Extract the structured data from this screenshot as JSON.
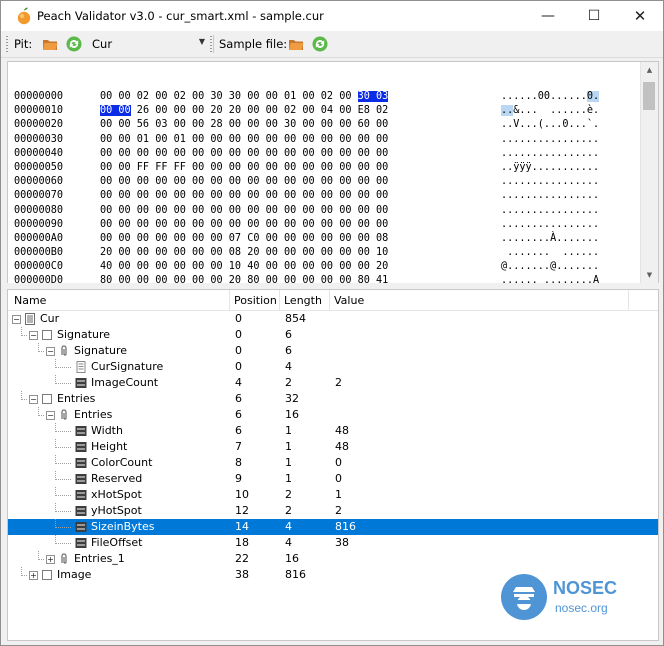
{
  "window": {
    "title": "Peach Validator v3.0 - cur_smart.xml - sample.cur",
    "minimize_glyph": "—",
    "maximize_glyph": "☐",
    "close_glyph": "✕"
  },
  "toolbar": {
    "pit_label": "Pit:",
    "pit_value": "Cur",
    "sample_label": "Sample file:"
  },
  "hex": {
    "rows": [
      {
        "offset": "00000000",
        "bytes_pre": "00 00 02 00 02 00 30 30 00 00 01 00 02 00 ",
        "bytes_sel": "30 03",
        "bytes_post": "",
        "ascii_pre": "......00......",
        "ascii_sel": "0.",
        "ascii_post": ""
      },
      {
        "offset": "00000010",
        "bytes_pre": "",
        "bytes_sel": "00 00",
        "bytes_post": " 26 00 00 00 20 20 00 00 02 00 04 00 E8 02",
        "ascii_pre": "",
        "ascii_sel": "..",
        "ascii_post": "&...  ......è."
      },
      {
        "offset": "00000020",
        "bytes_pre": "00 00 56 03 00 00 28 00 00 00 30 00 00 00 60 00",
        "bytes_sel": "",
        "bytes_post": "",
        "ascii_pre": "..V...(...0...`.",
        "ascii_sel": "",
        "ascii_post": ""
      },
      {
        "offset": "00000030",
        "bytes_pre": "00 00 01 00 01 00 00 00 00 00 00 00 00 00 00 00",
        "bytes_sel": "",
        "bytes_post": "",
        "ascii_pre": "................",
        "ascii_sel": "",
        "ascii_post": ""
      },
      {
        "offset": "00000040",
        "bytes_pre": "00 00 00 00 00 00 00 00 00 00 00 00 00 00 00 00",
        "bytes_sel": "",
        "bytes_post": "",
        "ascii_pre": "................",
        "ascii_sel": "",
        "ascii_post": ""
      },
      {
        "offset": "00000050",
        "bytes_pre": "00 00 FF FF FF 00 00 00 00 00 00 00 00 00 00 00",
        "bytes_sel": "",
        "bytes_post": "",
        "ascii_pre": "..ÿÿÿ...........",
        "ascii_sel": "",
        "ascii_post": ""
      },
      {
        "offset": "00000060",
        "bytes_pre": "00 00 00 00 00 00 00 00 00 00 00 00 00 00 00 00",
        "bytes_sel": "",
        "bytes_post": "",
        "ascii_pre": "................",
        "ascii_sel": "",
        "ascii_post": ""
      },
      {
        "offset": "00000070",
        "bytes_pre": "00 00 00 00 00 00 00 00 00 00 00 00 00 00 00 00",
        "bytes_sel": "",
        "bytes_post": "",
        "ascii_pre": "................",
        "ascii_sel": "",
        "ascii_post": ""
      },
      {
        "offset": "00000080",
        "bytes_pre": "00 00 00 00 00 00 00 00 00 00 00 00 00 00 00 00",
        "bytes_sel": "",
        "bytes_post": "",
        "ascii_pre": "................",
        "ascii_sel": "",
        "ascii_post": ""
      },
      {
        "offset": "00000090",
        "bytes_pre": "00 00 00 00 00 00 00 00 00 00 00 00 00 00 00 00",
        "bytes_sel": "",
        "bytes_post": "",
        "ascii_pre": "................",
        "ascii_sel": "",
        "ascii_post": ""
      },
      {
        "offset": "000000A0",
        "bytes_pre": "00 00 00 00 00 00 00 07 C0 00 00 00 00 00 00 08",
        "bytes_sel": "",
        "bytes_post": "",
        "ascii_pre": "........À.......",
        "ascii_sel": "",
        "ascii_post": ""
      },
      {
        "offset": "000000B0",
        "bytes_pre": "20 00 00 00 00 00 00 08 20 00 00 00 00 00 00 10",
        "bytes_sel": "",
        "bytes_post": "",
        "ascii_pre": " .......  ......",
        "ascii_sel": "",
        "ascii_post": ""
      },
      {
        "offset": "000000C0",
        "bytes_pre": "40 00 00 00 00 00 00 10 40 00 00 00 00 00 00 20",
        "bytes_sel": "",
        "bytes_post": "",
        "ascii_pre": "@.......@.......",
        "ascii_sel": "",
        "ascii_post": ""
      },
      {
        "offset": "000000D0",
        "bytes_pre": "80 00 00 00 00 00 00 20 80 00 00 00 00 00 80 41",
        "bytes_sel": "",
        "bytes_post": "",
        "ascii_pre": "...... ........A",
        "ascii_sel": "",
        "ascii_post": ""
      }
    ]
  },
  "tree": {
    "columns": {
      "name": "Name",
      "position": "Position",
      "length": "Length",
      "value": "Value"
    },
    "rows": [
      {
        "name": "Cur",
        "position": "0",
        "length": "854",
        "value": "",
        "depth": 0,
        "expander": "−",
        "icon": "document-icon"
      },
      {
        "name": "Signature",
        "position": "0",
        "length": "6",
        "value": "",
        "depth": 1,
        "expander": "−",
        "icon": "block-icon"
      },
      {
        "name": "Signature",
        "position": "0",
        "length": "6",
        "value": "",
        "depth": 2,
        "expander": "−",
        "icon": "paperclip-icon"
      },
      {
        "name": "CurSignature",
        "position": "0",
        "length": "4",
        "value": "",
        "depth": 3,
        "expander": "",
        "icon": "text-file-icon"
      },
      {
        "name": "ImageCount",
        "position": "4",
        "length": "2",
        "value": "2",
        "depth": 3,
        "expander": "",
        "icon": "number-icon"
      },
      {
        "name": "Entries",
        "position": "6",
        "length": "32",
        "value": "",
        "depth": 1,
        "expander": "−",
        "icon": "block-icon"
      },
      {
        "name": "Entries",
        "position": "6",
        "length": "16",
        "value": "",
        "depth": 2,
        "expander": "−",
        "icon": "paperclip-icon"
      },
      {
        "name": "Width",
        "position": "6",
        "length": "1",
        "value": "48",
        "depth": 3,
        "expander": "",
        "icon": "number-icon"
      },
      {
        "name": "Height",
        "position": "7",
        "length": "1",
        "value": "48",
        "depth": 3,
        "expander": "",
        "icon": "number-icon"
      },
      {
        "name": "ColorCount",
        "position": "8",
        "length": "1",
        "value": "0",
        "depth": 3,
        "expander": "",
        "icon": "number-icon"
      },
      {
        "name": "Reserved",
        "position": "9",
        "length": "1",
        "value": "0",
        "depth": 3,
        "expander": "",
        "icon": "number-icon"
      },
      {
        "name": "xHotSpot",
        "position": "10",
        "length": "2",
        "value": "1",
        "depth": 3,
        "expander": "",
        "icon": "number-icon"
      },
      {
        "name": "yHotSpot",
        "position": "12",
        "length": "2",
        "value": "2",
        "depth": 3,
        "expander": "",
        "icon": "number-icon"
      },
      {
        "name": "SizeinBytes",
        "position": "14",
        "length": "4",
        "value": "816",
        "depth": 3,
        "expander": "",
        "icon": "number-icon",
        "selected": true
      },
      {
        "name": "FileOffset",
        "position": "18",
        "length": "4",
        "value": "38",
        "depth": 3,
        "expander": "",
        "icon": "number-icon"
      },
      {
        "name": "Entries_1",
        "position": "22",
        "length": "16",
        "value": "",
        "depth": 2,
        "expander": "+",
        "icon": "paperclip-icon"
      },
      {
        "name": "Image",
        "position": "38",
        "length": "816",
        "value": "",
        "depth": 1,
        "expander": "+",
        "icon": "block-icon"
      }
    ]
  },
  "watermark": {
    "title": "NOSEC",
    "subtitle": "nosec.org"
  },
  "colors": {
    "selection": "#0078d7",
    "hex_selection": "#0a2ce6",
    "ascii_selection": "#b9d6f2",
    "watermark": "#4f95d6"
  }
}
